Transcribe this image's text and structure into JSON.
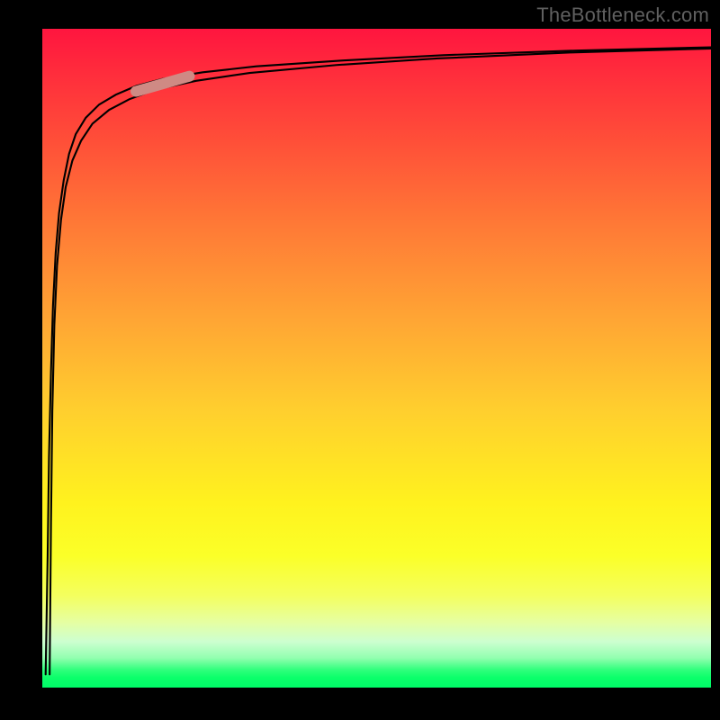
{
  "attribution": "TheBottleneck.com",
  "chart_data": {
    "type": "area",
    "title": "",
    "xlabel": "",
    "ylabel": "",
    "xlim": [
      0,
      100
    ],
    "ylim": [
      0,
      100
    ],
    "series": [
      {
        "name": "curve",
        "x": [
          0.5,
          0.8,
          1.0,
          1.3,
          1.6,
          2.0,
          2.5,
          3.2,
          4.0,
          5.0,
          6.5,
          8.5,
          11,
          14,
          18,
          24,
          32,
          45,
          60,
          80,
          100
        ],
        "values": [
          2,
          20,
          35,
          48,
          58,
          66,
          72,
          77,
          81,
          84,
          86.5,
          88.5,
          90,
          91.3,
          92.4,
          93.4,
          94.3,
          95.2,
          96,
          96.7,
          97.2
        ]
      },
      {
        "name": "curve-inner",
        "x": [
          1.1,
          1.3,
          1.5,
          1.8,
          2.2,
          2.8,
          3.5,
          4.5,
          5.8,
          7.5,
          10,
          13,
          17,
          23,
          31,
          44,
          59,
          79,
          100
        ],
        "values": [
          2,
          25,
          42,
          55,
          64,
          71,
          76,
          80,
          83,
          85.6,
          87.7,
          89.3,
          90.8,
          92.1,
          93.3,
          94.5,
          95.5,
          96.4,
          97.0
        ]
      }
    ],
    "highlight_segment": {
      "x": [
        14,
        22
      ],
      "y": [
        90.5,
        92.8
      ]
    },
    "background_gradient_stops": [
      {
        "pos": 0.0,
        "color": "#ff153f"
      },
      {
        "pos": 0.18,
        "color": "#ff5238"
      },
      {
        "pos": 0.44,
        "color": "#ffa534"
      },
      {
        "pos": 0.72,
        "color": "#fff21e"
      },
      {
        "pos": 0.9,
        "color": "#e6ffa1"
      },
      {
        "pos": 0.97,
        "color": "#30ff7c"
      },
      {
        "pos": 1.0,
        "color": "#00fb68"
      }
    ]
  }
}
